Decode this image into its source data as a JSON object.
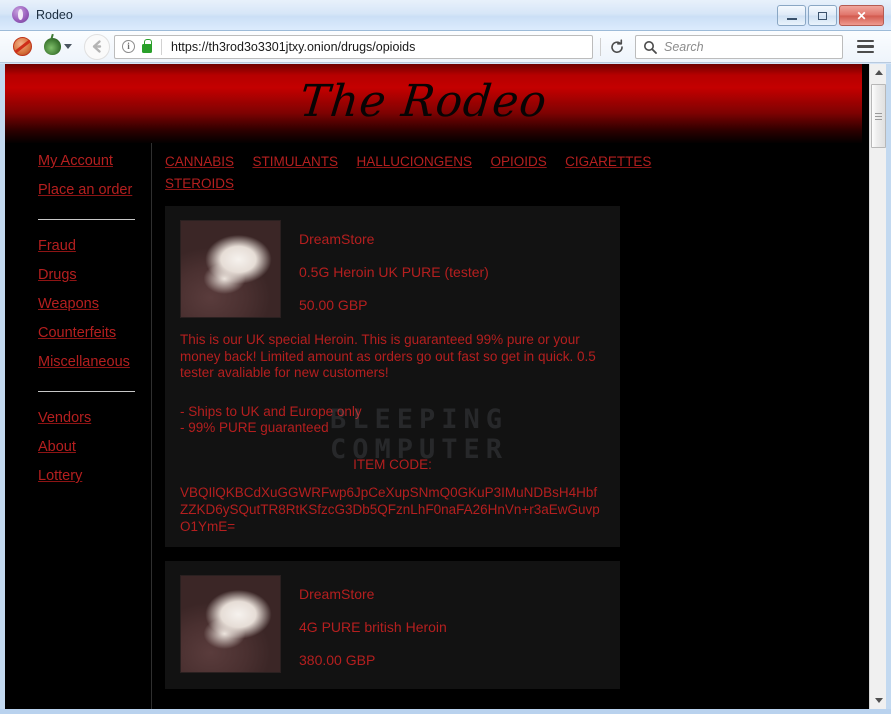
{
  "window": {
    "title": "Rodeo",
    "logo_icon": "tor-onion-logo-icon",
    "minimize_label": "",
    "maximize_label": "",
    "close_label": "✕"
  },
  "toolbar": {
    "noscript_icon": "noscript-icon",
    "onion_icon": "onion-icon",
    "back_icon": "back-arrow-icon",
    "info_icon": "ⓘ",
    "info_letter": "i",
    "lock_icon": "padlock-icon",
    "url": "https://th3rod3o3301jtxy.onion/drugs/opioids",
    "reload_icon": "reload-icon",
    "search_placeholder": "Search",
    "search_icon": "search-icon",
    "menu_icon": "hamburger-menu-icon"
  },
  "site": {
    "banner_title": "The Rodeo",
    "watermark_line1": "BLEEPING",
    "watermark_line2": "COMPUTER",
    "accent_color": "#b51f1f",
    "banner_color": "#c40000",
    "background_color": "#000000"
  },
  "sidebar": {
    "group1": [
      {
        "label": "My Account"
      },
      {
        "label": "Place an order"
      }
    ],
    "group2": [
      {
        "label": "Fraud"
      },
      {
        "label": "Drugs"
      },
      {
        "label": "Weapons"
      },
      {
        "label": "Counterfeits"
      },
      {
        "label": "Miscellaneous"
      }
    ],
    "group3": [
      {
        "label": "Vendors"
      },
      {
        "label": "About"
      },
      {
        "label": "Lottery"
      }
    ]
  },
  "topnav": [
    {
      "label": "CANNABIS"
    },
    {
      "label": "STIMULANTS"
    },
    {
      "label": "HALLUCIONGENS"
    },
    {
      "label": "OPIOIDS"
    },
    {
      "label": "CIGARETTES"
    },
    {
      "label": "STEROIDS"
    }
  ],
  "listings": [
    {
      "vendor": "DreamStore",
      "name": "0.5G Heroin UK PURE (tester)",
      "price": "50.00 GBP",
      "thumb_icon": "product-photo-heroin",
      "description": "This is our UK special Heroin. This is guaranteed 99% pure or your money back! Limited amount as orders go out fast so get in quick. 0.5 tester avaliable for new customers!",
      "bullets": "- Ships to UK and Europe only\n- 99% PURE guaranteed",
      "item_code_label": "ITEM CODE:",
      "item_code": "VBQIlQKBCdXuGGWRFwp6JpCeXupSNmQ0GKuP3IMuNDBsH4HbfZZKD6ySQutTR8RtKSfzcG3Db5QFznLhF0naFA26HnVn+r3aEwGuvpO1YmE="
    },
    {
      "vendor": "DreamStore",
      "name": "4G PURE british Heroin",
      "price": "380.00 GBP",
      "thumb_icon": "product-photo-heroin"
    }
  ]
}
